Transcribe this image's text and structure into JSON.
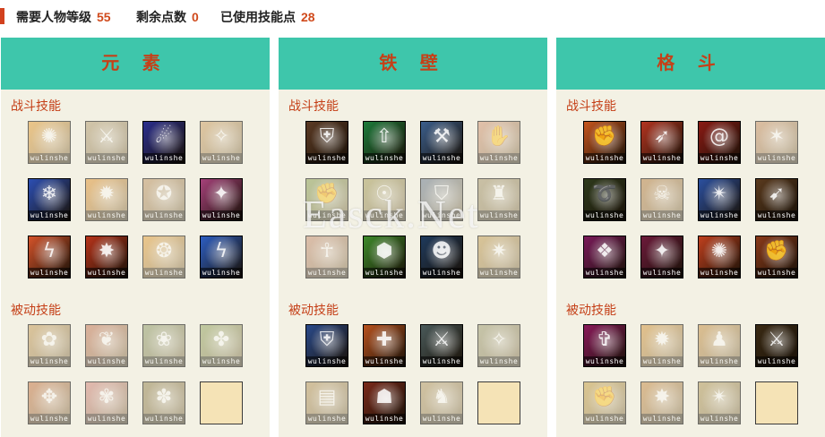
{
  "summary": {
    "level_label": "需要人物等级",
    "level_value": "55",
    "remaining_label": "剩余点数",
    "remaining_value": "0",
    "used_label": "已使用技能点",
    "used_value": "28"
  },
  "section_labels": {
    "combat": "战斗技能",
    "passive": "被动技能"
  },
  "skill_watermark": "wulinshe",
  "site_watermark": "Easck.Net",
  "colors": {
    "accent": "#d2411e",
    "header": "#3ec6ab",
    "panel_bg": "#f3f1e4",
    "empty_slot": "#f5e3b6"
  },
  "panels": [
    {
      "title": "元 素",
      "combat": [
        {
          "color": "#e7a23c",
          "glyph": "✺",
          "faded": true
        },
        {
          "color": "#b7a27a",
          "glyph": "⚔",
          "faded": true
        },
        {
          "color": "#2b2f8e",
          "glyph": "☄",
          "faded": false
        },
        {
          "color": "#d0a46a",
          "glyph": "✧",
          "faded": true
        },
        {
          "color": "#2c4fb4",
          "glyph": "❄",
          "faded": false
        },
        {
          "color": "#e49a3a",
          "glyph": "✹",
          "faded": true
        },
        {
          "color": "#c09a6c",
          "glyph": "✪",
          "faded": true
        },
        {
          "color": "#a6417a",
          "glyph": "✦",
          "faded": false
        },
        {
          "color": "#d5532a",
          "glyph": "ϟ",
          "faded": false
        },
        {
          "color": "#b8341a",
          "glyph": "✸",
          "faded": false
        },
        {
          "color": "#e4a342",
          "glyph": "❂",
          "faded": true
        },
        {
          "color": "#2d5ec2",
          "glyph": "ϟ",
          "faded": false
        }
      ],
      "passive": [
        {
          "color": "#c8a060",
          "glyph": "✿",
          "faded": true
        },
        {
          "color": "#c77b5c",
          "glyph": "❦",
          "faded": true
        },
        {
          "color": "#93a070",
          "glyph": "❀",
          "faded": true
        },
        {
          "color": "#97a866",
          "glyph": "✤",
          "faded": true
        },
        {
          "color": "#c87a4a",
          "glyph": "✥",
          "faded": true
        },
        {
          "color": "#d58b82",
          "glyph": "✾",
          "faded": true
        },
        {
          "color": "#9a8a5a",
          "glyph": "✽",
          "faded": true
        },
        {
          "empty": true
        }
      ]
    },
    {
      "title": "铁 壁",
      "combat": [
        {
          "color": "#5b3a24",
          "glyph": "⛨",
          "faded": false
        },
        {
          "color": "#1d7b3a",
          "glyph": "⇧",
          "faded": false
        },
        {
          "color": "#3b5e8c",
          "glyph": "⚒",
          "faded": false
        },
        {
          "color": "#d49a7a",
          "glyph": "✋",
          "faded": true
        },
        {
          "color": "#8ca25a",
          "glyph": "✊",
          "faded": true
        },
        {
          "color": "#a8a060",
          "glyph": "☉",
          "faded": true
        },
        {
          "color": "#6f7e92",
          "glyph": "⛉",
          "faded": true
        },
        {
          "color": "#a89a72",
          "glyph": "♜",
          "faded": true
        },
        {
          "color": "#c9957a",
          "glyph": "☥",
          "faded": true
        },
        {
          "color": "#3e8a2a",
          "glyph": "⬢",
          "faded": false
        },
        {
          "color": "#1f3a5c",
          "glyph": "☻",
          "faded": false
        },
        {
          "color": "#c4a05a",
          "glyph": "✷",
          "faded": true
        }
      ],
      "passive": [
        {
          "color": "#2a4a8a",
          "glyph": "⛨",
          "faded": false
        },
        {
          "color": "#b8521e",
          "glyph": "✚",
          "faded": false
        },
        {
          "color": "#4a5a5a",
          "glyph": "⚔",
          "faded": false
        },
        {
          "color": "#a2a078",
          "glyph": "✧",
          "faded": true
        },
        {
          "color": "#b89a64",
          "glyph": "▤",
          "faded": true
        },
        {
          "color": "#7a2a1a",
          "glyph": "☗",
          "faded": false
        },
        {
          "color": "#b59c6a",
          "glyph": "♞",
          "faded": true
        },
        {
          "empty": true
        }
      ]
    },
    {
      "title": "格 斗",
      "combat": [
        {
          "color": "#c7561e",
          "glyph": "✊",
          "faded": false
        },
        {
          "color": "#b43420",
          "glyph": "➶",
          "faded": false
        },
        {
          "color": "#8a1a14",
          "glyph": "@",
          "faded": false
        },
        {
          "color": "#c8946a",
          "glyph": "✶",
          "faded": true
        },
        {
          "color": "#2e3a1c",
          "glyph": "➰",
          "faded": false
        },
        {
          "color": "#b8844a",
          "glyph": "☠",
          "faded": true
        },
        {
          "color": "#2b50a0",
          "glyph": "✴",
          "faded": false
        },
        {
          "color": "#5a3a1e",
          "glyph": "➹",
          "faded": false
        },
        {
          "color": "#7a1a5a",
          "glyph": "❖",
          "faded": false
        },
        {
          "color": "#6c1a3a",
          "glyph": "✦",
          "faded": false
        },
        {
          "color": "#c0401e",
          "glyph": "✺",
          "faded": false
        },
        {
          "color": "#8a3a1a",
          "glyph": "✊",
          "faded": false
        }
      ],
      "passive": [
        {
          "color": "#8a1a5a",
          "glyph": "✞",
          "faded": false
        },
        {
          "color": "#d59a44",
          "glyph": "✹",
          "faded": true
        },
        {
          "color": "#c8944a",
          "glyph": "♟",
          "faded": true
        },
        {
          "color": "#3a2a14",
          "glyph": "⚔",
          "faded": false
        },
        {
          "color": "#c8a24a",
          "glyph": "✊",
          "faded": true
        },
        {
          "color": "#c9904c",
          "glyph": "✸",
          "faded": true
        },
        {
          "color": "#b29a5c",
          "glyph": "✴",
          "faded": true
        },
        {
          "empty": true
        }
      ]
    }
  ]
}
